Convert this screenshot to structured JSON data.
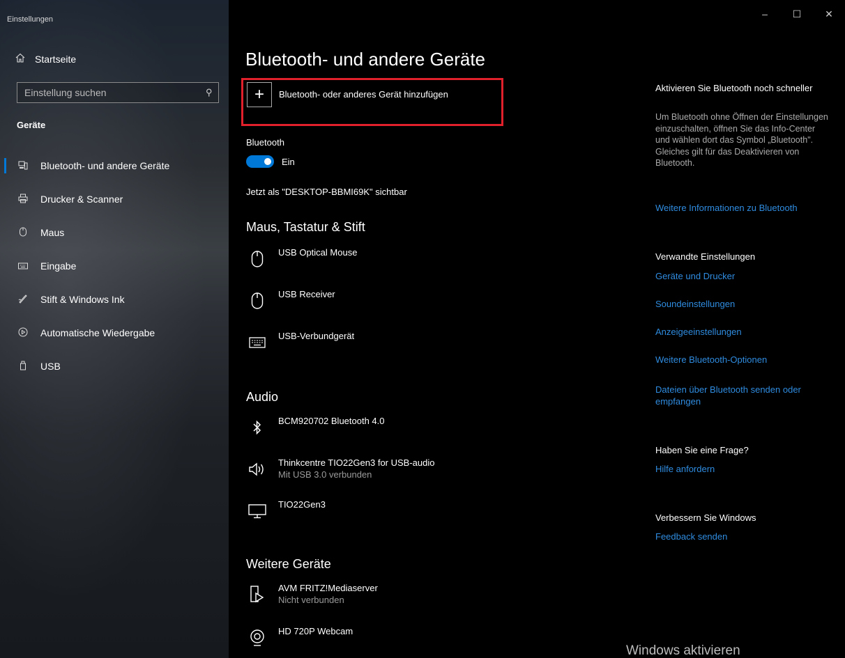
{
  "window": {
    "title": "Einstellungen",
    "controls": {
      "minimize": "–",
      "maximize": "☐",
      "close": "✕"
    }
  },
  "sidebar": {
    "home_label": "Startseite",
    "search_placeholder": "Einstellung suchen",
    "section_label": "Geräte",
    "items": [
      {
        "label": "Bluetooth- und andere Geräte",
        "icon": "bluetooth-devices-icon",
        "active": true
      },
      {
        "label": "Drucker & Scanner",
        "icon": "printer-icon"
      },
      {
        "label": "Maus",
        "icon": "mouse-icon"
      },
      {
        "label": "Eingabe",
        "icon": "keyboard-icon"
      },
      {
        "label": "Stift & Windows Ink",
        "icon": "pen-icon"
      },
      {
        "label": "Automatische Wiedergabe",
        "icon": "autoplay-icon"
      },
      {
        "label": "USB",
        "icon": "usb-icon"
      }
    ]
  },
  "main": {
    "title": "Bluetooth- und andere Geräte",
    "add_device_label": "Bluetooth- oder anderes Gerät hinzufügen",
    "bluetooth_label": "Bluetooth",
    "bluetooth_state": "Ein",
    "visible_text": "Jetzt als \"DESKTOP-BBMI69K\" sichtbar",
    "groups": {
      "input": {
        "title": "Maus, Tastatur & Stift",
        "devices": [
          {
            "name": "USB Optical Mouse",
            "icon": "mouse-icon"
          },
          {
            "name": "USB Receiver",
            "icon": "mouse-icon"
          },
          {
            "name": "USB-Verbundgerät",
            "icon": "keyboard-icon"
          }
        ]
      },
      "audio": {
        "title": "Audio",
        "devices": [
          {
            "name": "BCM920702 Bluetooth 4.0",
            "icon": "bluetooth-icon"
          },
          {
            "name": "Thinkcentre TIO22Gen3 for USB-audio",
            "status": "Mit USB 3.0 verbunden",
            "icon": "speaker-icon"
          },
          {
            "name": "TIO22Gen3",
            "icon": "monitor-icon"
          }
        ]
      },
      "other": {
        "title": "Weitere Geräte",
        "devices": [
          {
            "name": "AVM FRITZ!Mediaserver",
            "status": "Nicht verbunden",
            "icon": "media-server-icon"
          },
          {
            "name": "HD 720P Webcam",
            "icon": "webcam-icon"
          }
        ]
      }
    }
  },
  "right": {
    "faster_title": "Aktivieren Sie Bluetooth noch schneller",
    "faster_text": "Um Bluetooth ohne Öffnen der Einstellungen einzuschalten, öffnen Sie das Info-Center und wählen dort das Symbol „Bluetooth\". Gleiches gilt für das Deaktivieren von Bluetooth.",
    "faster_link": "Weitere Informationen zu Bluetooth",
    "related_title": "Verwandte Einstellungen",
    "related_links": [
      "Geräte und Drucker",
      "Soundeinstellungen",
      "Anzeigeeinstellungen",
      "Weitere Bluetooth-Optionen",
      "Dateien über Bluetooth senden oder empfangen"
    ],
    "question_title": "Haben Sie eine Frage?",
    "question_link": "Hilfe anfordern",
    "improve_title": "Verbessern Sie Windows",
    "improve_link": "Feedback senden"
  },
  "watermark": "Windows aktivieren",
  "colors": {
    "accent": "#0078d7",
    "link": "#2f8ce0",
    "highlight": "#e0202a"
  }
}
